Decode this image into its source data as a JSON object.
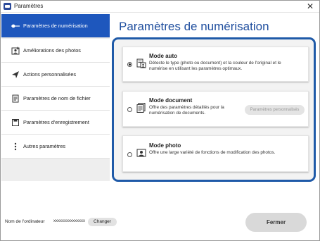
{
  "window": {
    "title": "Paramètres"
  },
  "sidebar": {
    "items": [
      {
        "label": "Paramètres de numérisation",
        "icon": "scan-slider-icon"
      },
      {
        "label": "Améliorations des photos",
        "icon": "photo-enhance-icon"
      },
      {
        "label": "Actions personnalisées",
        "icon": "send-icon"
      },
      {
        "label": "Paramètres de nom de fichier",
        "icon": "file-name-icon"
      },
      {
        "label": "Paramètres d'enregistrement",
        "icon": "save-folder-icon"
      },
      {
        "label": "Autres paramètres",
        "icon": "more-vertical-icon"
      }
    ]
  },
  "main": {
    "title": "Paramètres de numérisation",
    "modes": [
      {
        "title": "Mode auto",
        "desc_line1": "Détecte le type (photo ou document) et la couleur de l'original et le",
        "desc_line2": "numérise en utilisant les paramètres optimaux.",
        "selected": true
      },
      {
        "title": "Mode document",
        "desc_line1": "Offre des paramètres détaillés pour la",
        "desc_line2": "numérisation de documents.",
        "button_label": "Paramètres personnalisés",
        "selected": false
      },
      {
        "title": "Mode photo",
        "desc_line1": "Offre une large variété de fonctions de modification des photos.",
        "selected": false
      }
    ]
  },
  "footer": {
    "computer_label": "Nom de l'ordinateur",
    "computer_value": "xxxxxxxxxxxxxxx",
    "change_label": "Changer",
    "close_label": "Fermer"
  },
  "colors": {
    "accent": "#1e57bd",
    "title": "#1f4e9e",
    "panel_border": "#1f5aa8"
  }
}
